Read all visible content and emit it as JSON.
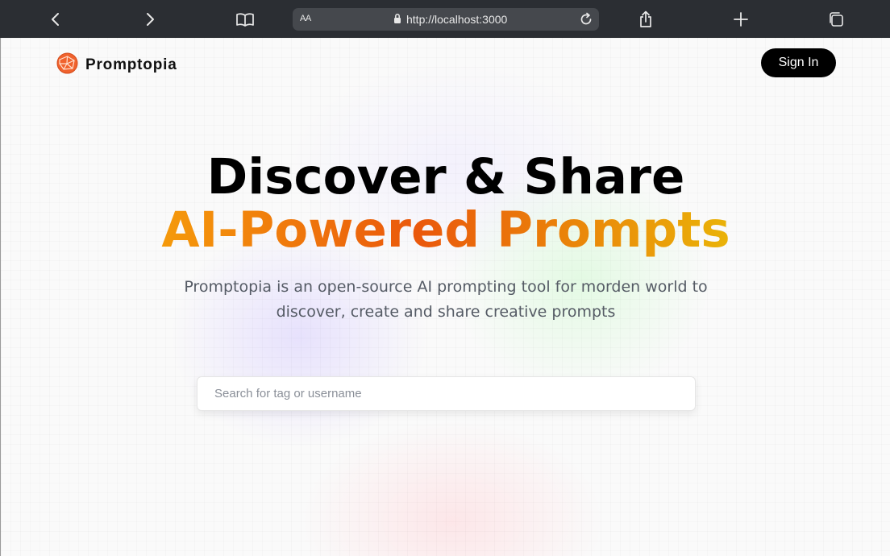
{
  "browser": {
    "aa_label": "AA",
    "url": "http://localhost:3000",
    "icons": [
      "back-icon",
      "forward-icon",
      "book-icon",
      "lock-icon",
      "reload-icon",
      "share-icon",
      "plus-icon",
      "tabs-icon"
    ]
  },
  "nav": {
    "brand": "Promptopia",
    "logo_icon": "promptopia-logo",
    "sign_in_label": "Sign In"
  },
  "hero": {
    "headline": "Discover & Share",
    "highlight": "AI-Powered Prompts",
    "description": "Promptopia is an open-source AI prompting tool for morden world to discover, create and share creative prompts"
  },
  "search": {
    "placeholder": "Search for tag or username",
    "value": ""
  },
  "colors": {
    "gradient_start": "#f59a0b",
    "gradient_mid": "#ea580c",
    "gradient_end": "#eab308",
    "button_bg": "#000000",
    "chrome_bg": "#2b2e33"
  }
}
